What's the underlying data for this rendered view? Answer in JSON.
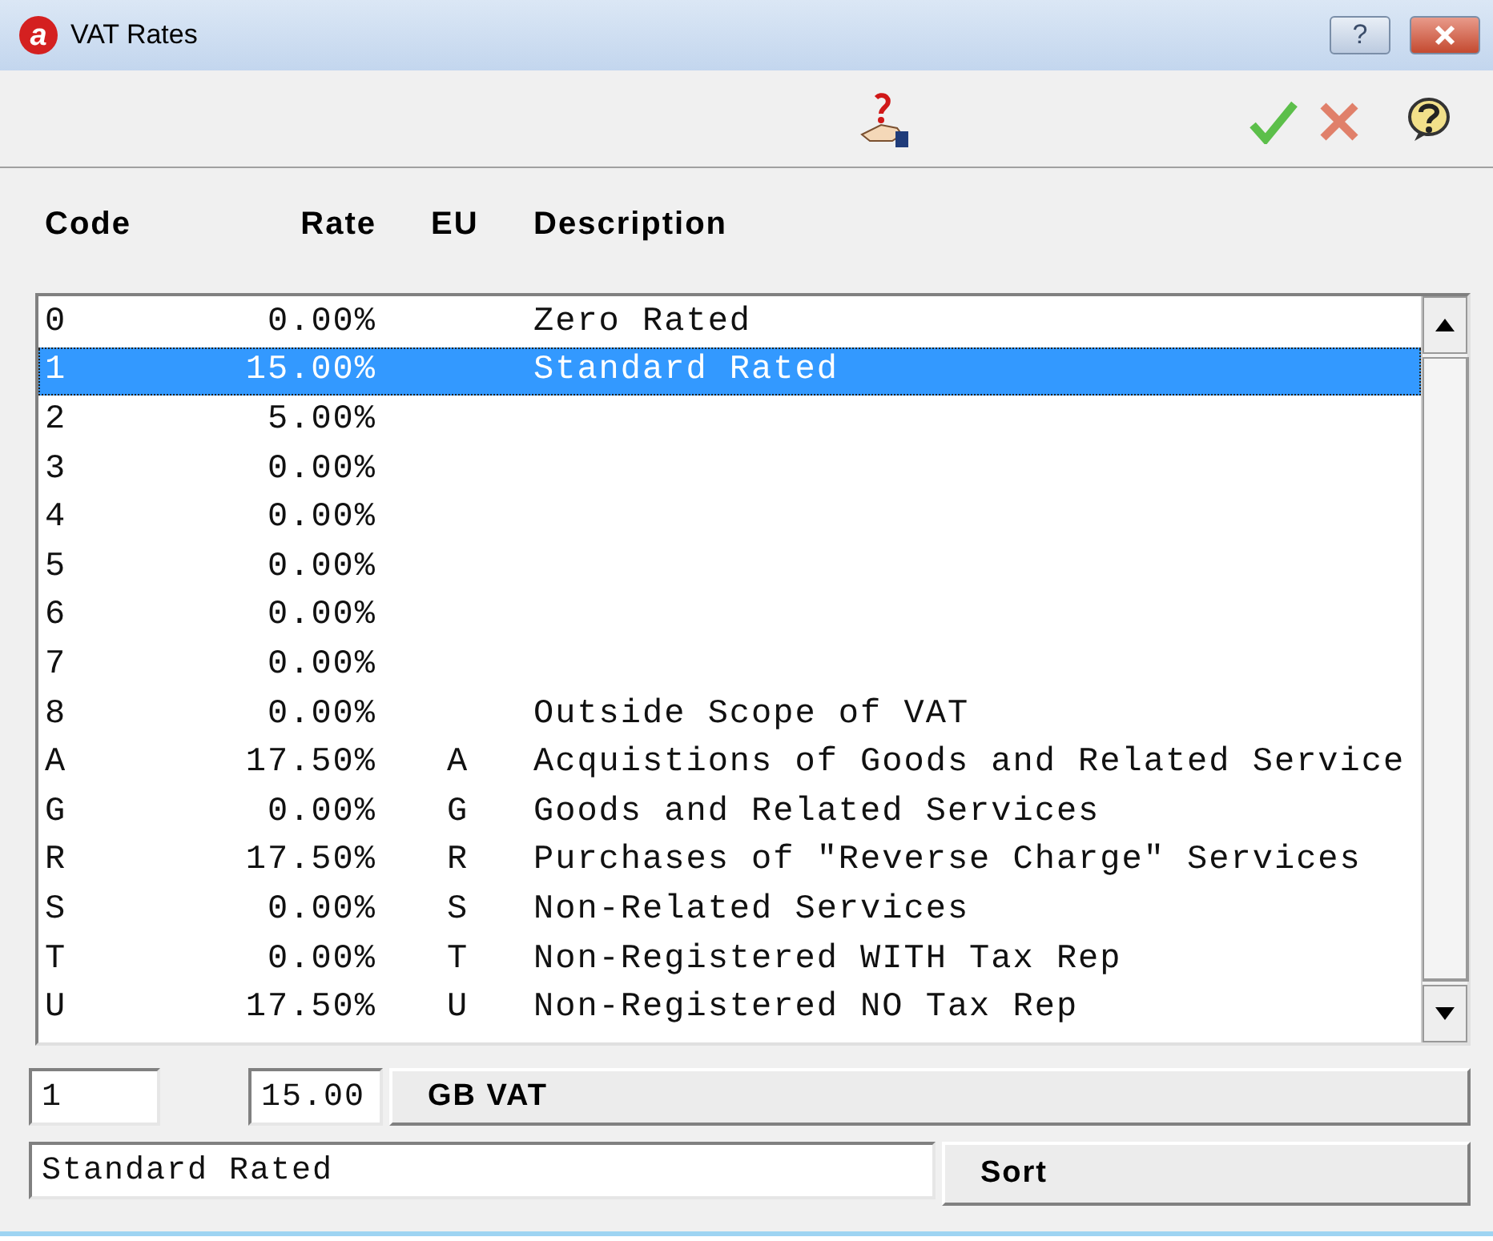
{
  "window": {
    "logo": "a",
    "title": "VAT Rates",
    "help_button": "?"
  },
  "columns": [
    "Code",
    "Rate",
    "EU",
    "Description"
  ],
  "rows": [
    {
      "code": "0",
      "rate": "0.00%",
      "eu": "",
      "description": "Zero Rated",
      "selected": false
    },
    {
      "code": "1",
      "rate": "15.00%",
      "eu": "",
      "description": "Standard Rated",
      "selected": true
    },
    {
      "code": "2",
      "rate": "5.00%",
      "eu": "",
      "description": "",
      "selected": false
    },
    {
      "code": "3",
      "rate": "0.00%",
      "eu": "",
      "description": "",
      "selected": false
    },
    {
      "code": "4",
      "rate": "0.00%",
      "eu": "",
      "description": "",
      "selected": false
    },
    {
      "code": "5",
      "rate": "0.00%",
      "eu": "",
      "description": "",
      "selected": false
    },
    {
      "code": "6",
      "rate": "0.00%",
      "eu": "",
      "description": "",
      "selected": false
    },
    {
      "code": "7",
      "rate": "0.00%",
      "eu": "",
      "description": "",
      "selected": false
    },
    {
      "code": "8",
      "rate": "0.00%",
      "eu": "",
      "description": "Outside Scope of VAT",
      "selected": false
    },
    {
      "code": "A",
      "rate": "17.50%",
      "eu": "A",
      "description": "Acquistions of Goods and Related Service",
      "selected": false
    },
    {
      "code": "G",
      "rate": "0.00%",
      "eu": "G",
      "description": "Goods and Related Services",
      "selected": false
    },
    {
      "code": "R",
      "rate": "17.50%",
      "eu": "R",
      "description": "Purchases of \"Reverse Charge\" Services",
      "selected": false
    },
    {
      "code": "S",
      "rate": "0.00%",
      "eu": "S",
      "description": "Non-Related Services",
      "selected": false
    },
    {
      "code": "T",
      "rate": "0.00%",
      "eu": "T",
      "description": "Non-Registered WITH Tax Rep",
      "selected": false
    },
    {
      "code": "U",
      "rate": "17.50%",
      "eu": "U",
      "description": "Non-Registered NO Tax Rep",
      "selected": false
    }
  ],
  "form": {
    "code": "1",
    "rate": "15.00",
    "region_button": "GB VAT",
    "description": "Standard Rated",
    "sort_button": "Sort"
  }
}
